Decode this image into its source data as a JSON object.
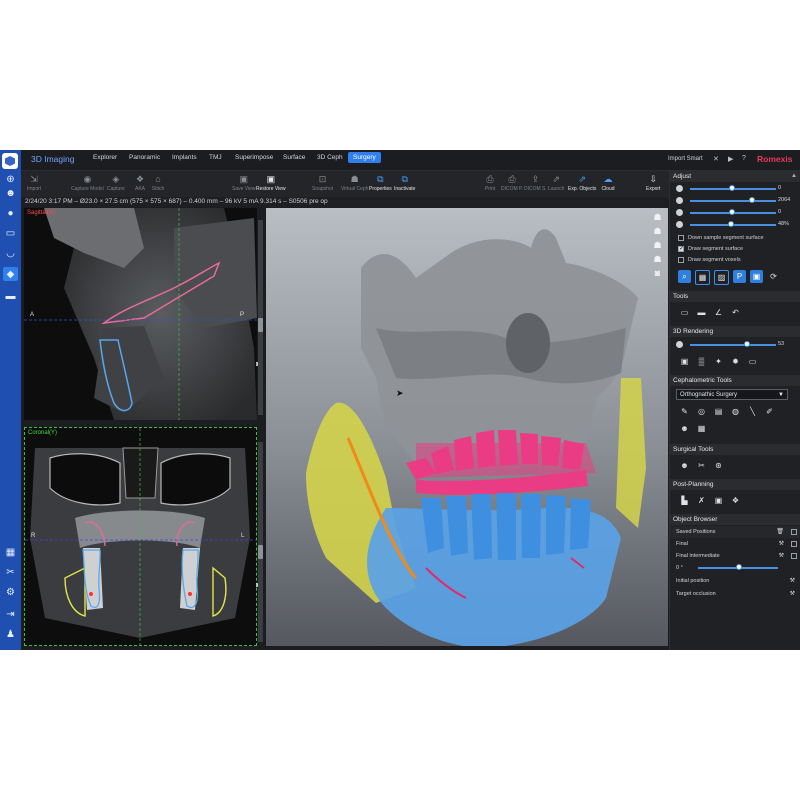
{
  "app": {
    "title": "3D Imaging",
    "brand": "Romexis"
  },
  "tabs": [
    {
      "label": "Explorer"
    },
    {
      "label": "Panoramic"
    },
    {
      "label": "Implants"
    },
    {
      "label": "TMJ"
    },
    {
      "label": "Superimpose"
    },
    {
      "label": "Surface"
    },
    {
      "label": "3D Ceph"
    },
    {
      "label": "Surgery",
      "active": true
    }
  ],
  "topbar": {
    "import_smart": "Import Smart"
  },
  "toolbar": {
    "import": "Import",
    "capture_model": "Capture Model",
    "capture": "Capture",
    "aka": "AKA",
    "stitch": "Stitch",
    "save_view": "Save View",
    "restore_view": "Restore View",
    "snapshot": "Snapshot",
    "virtual_ceph": "Virtual Ceph",
    "properties": "Properties",
    "inactivate": "Inactivate",
    "print": "Print",
    "dicom_p": "DICOM P.",
    "dicom_s": "DICOM S.",
    "launch": "Launch",
    "exp_objects": "Exp. Objects",
    "cloud": "Cloud",
    "export": "Export"
  },
  "status_line": "2/24/20 3:17 PM – Ø23.0 × 27.5 cm (575 × 575 × 687) – 0.400 mm – 96 kV 5 mA 9.314 s – S0506 pre op",
  "views": {
    "sagittal": {
      "label": "Sagittal(X)",
      "left": "A",
      "right": "P"
    },
    "coronal": {
      "label": "Coronal(Y)",
      "left": "R",
      "right": "L"
    }
  },
  "panel": {
    "adjust": {
      "title": "Adjust",
      "sliders": [
        {
          "icon": "brightness-icon",
          "value": "0",
          "level": 0.5
        },
        {
          "icon": "contrast-icon",
          "value": "2064",
          "level": 0.72
        },
        {
          "icon": "gamma-icon",
          "value": "0",
          "level": 0.5
        },
        {
          "icon": "opacity-icon",
          "value": "48%",
          "level": 0.48
        }
      ],
      "checks": [
        {
          "label": "Down sample segment surface",
          "checked": false
        },
        {
          "label": "Draw segment surface",
          "checked": true
        },
        {
          "label": "Draw segment voxels",
          "checked": false
        }
      ]
    },
    "tools": {
      "title": "Tools"
    },
    "rendering": {
      "title": "3D Rendering",
      "value": "53",
      "level": 0.65
    },
    "ceph": {
      "title": "Cephalometric Tools",
      "select": "Orthognathic Surgery"
    },
    "surgical": {
      "title": "Surgical Tools"
    },
    "post": {
      "title": "Post-Planning"
    },
    "object_browser": {
      "title": "Object Browser",
      "saved_positions": "Saved Positions",
      "rows": [
        {
          "label": "Final"
        },
        {
          "label": "Final intermediate"
        }
      ],
      "degree": "0 °",
      "degree_level": 0.6,
      "links": [
        {
          "label": "Initial position"
        },
        {
          "label": "Target occlusion"
        }
      ]
    }
  },
  "colors": {
    "accent": "#2f80ed",
    "rail": "#1f4fb0",
    "brand": "#e53b5a",
    "bone": "#8f9297",
    "mandible": "#5aa2e6",
    "maxilla": "#ea3c84",
    "ramus": "#d3d34a"
  }
}
